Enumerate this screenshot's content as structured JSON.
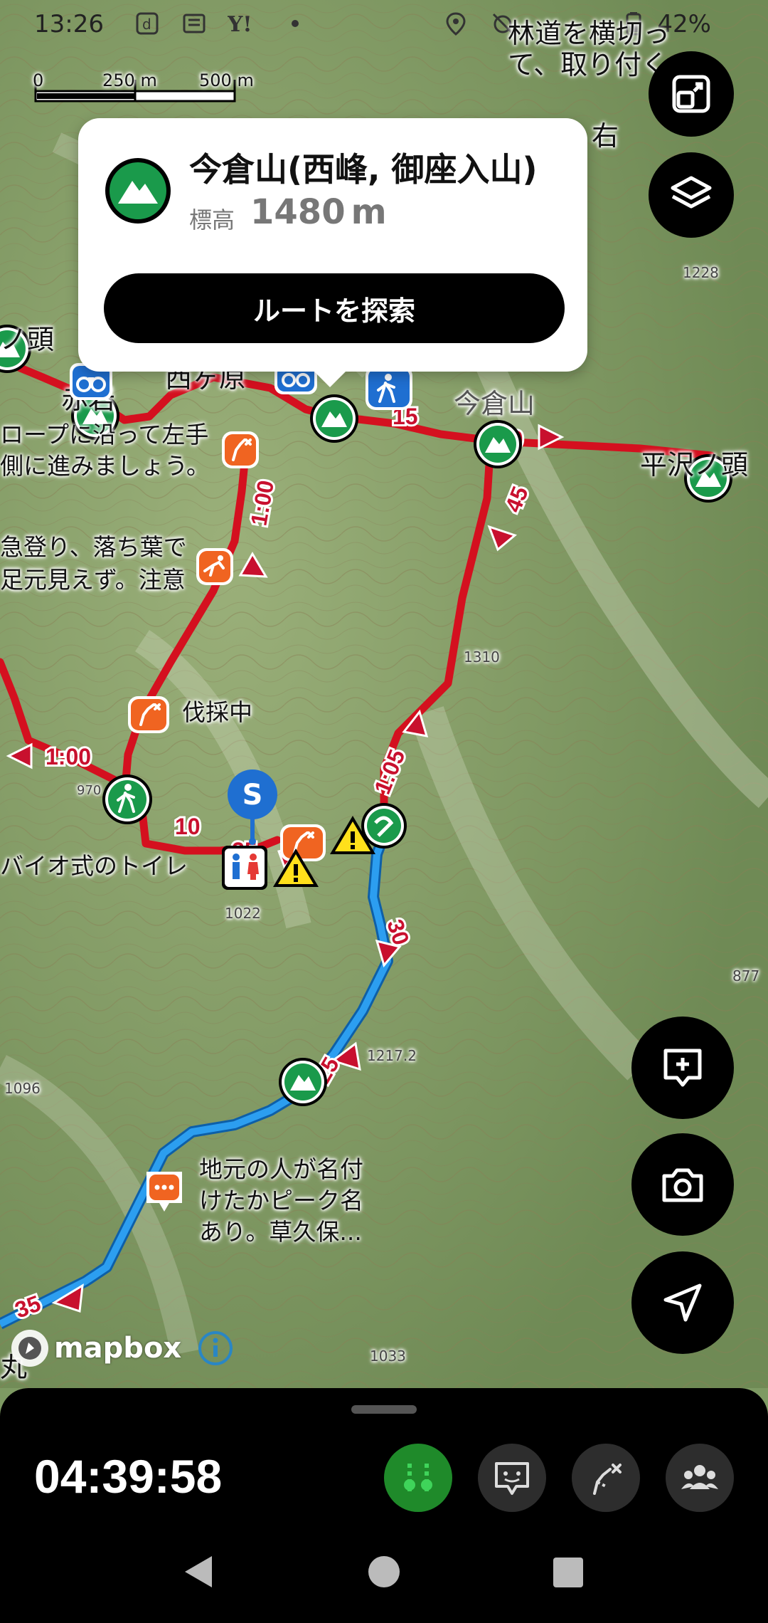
{
  "status_bar": {
    "time": "13:26",
    "battery": "42%",
    "icons": [
      "docomo-d-icon",
      "news-icon",
      "yahoo-icon",
      "dot-icon",
      "location-icon",
      "alarm-off-icon",
      "battery-icon"
    ]
  },
  "scale_bar": {
    "zero": "0",
    "mid": "250 m",
    "end": "500 m"
  },
  "popup": {
    "title": "今倉山(西峰, 御座入山)",
    "elevation_label": "標高",
    "elevation_value": "1480",
    "elevation_unit": "m",
    "button_label": "ルートを探索",
    "icon": "mountain-peak-icon"
  },
  "map_labels": {
    "top_right_1": "林道を横切っ",
    "top_right_2": "て、取り付く",
    "top_right_3": "右",
    "left_peak": "ノ頭",
    "akaiwa": "赤岩",
    "shiratobara": "西ヶ原",
    "rope_1": "ロープに沿って左手",
    "rope_2": "側に進みましょう。",
    "climb_1": "急登り、落ち葉で",
    "climb_2": "足元見えず。注意",
    "logging": "伐採中",
    "toilet": "バイオ式のトイレ",
    "imakurayama_map": "今倉山",
    "hirasawa": "平沢ノ頭",
    "local_1": "地元の人が名付",
    "local_2": "けたかピーク名",
    "local_3": "あり。草久保...",
    "maru": "丸",
    "elev_1228": "1228",
    "elev_1310": "1310",
    "elev_1022": "1022",
    "elev_1217": "1217.2",
    "elev_1096": "1096",
    "elev_1033": "1033",
    "elev_877": "877",
    "elev_970": "970"
  },
  "route_times": {
    "t15": "15",
    "t20": "20",
    "t45": "45",
    "t100a": "1:00",
    "t100b": "1:00",
    "t105": "1:05",
    "t10": "10",
    "t25a": "25",
    "t30": "30",
    "t25b": "25",
    "t35": "35"
  },
  "start_marker": "S",
  "attribution": {
    "brand": "mapbox",
    "info": "i"
  },
  "right_buttons": [
    "expand-icon",
    "layers-icon",
    "add-memo-icon",
    "camera-icon",
    "navigate-icon"
  ],
  "bottom_panel": {
    "timer": "04:39:58",
    "tools": [
      "route-pins-icon",
      "chat-icon",
      "route-branch-icon",
      "group-icon"
    ]
  },
  "colors": {
    "route_red": "#d4101f",
    "route_blue": "#1e8fe0",
    "peak_green": "#1a9a4b",
    "map_green": "#7e9a63"
  }
}
